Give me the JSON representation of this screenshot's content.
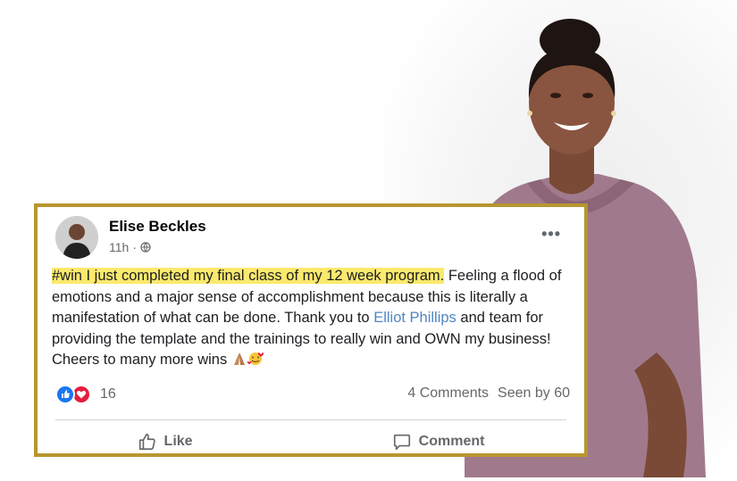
{
  "post": {
    "author": "Elise Beckles",
    "time": "11h",
    "meta_separator": "·",
    "more_label": "•••",
    "text": {
      "highlighted": "#win I just completed my final class of my 12 week program.",
      "part1": " Feeling a flood of emotions and a major sense of accomplishment because this is literally a manifestation of what can be done. Thank you to ",
      "mention": "Elliot Phillips",
      "part2": " and team for providing the template and the trainings to really win and OWN my business! Cheers to many more wins "
    },
    "reactions_count": "16",
    "comments": "4 Comments",
    "seen_by": "Seen by 60",
    "actions": {
      "like": "Like",
      "comment": "Comment"
    }
  },
  "colors": {
    "card_border": "#b8962e",
    "highlight": "#fbe96d",
    "mention": "#4f86c6",
    "like_blue": "#1877f2",
    "love_red": "#e41e3f"
  },
  "icons": [
    "globe-icon",
    "more-options-icon",
    "praying-hands-emoji",
    "smiling-face-hearts-emoji",
    "like-reaction-icon",
    "love-reaction-icon",
    "thumbs-up-icon",
    "comment-bubble-icon"
  ]
}
